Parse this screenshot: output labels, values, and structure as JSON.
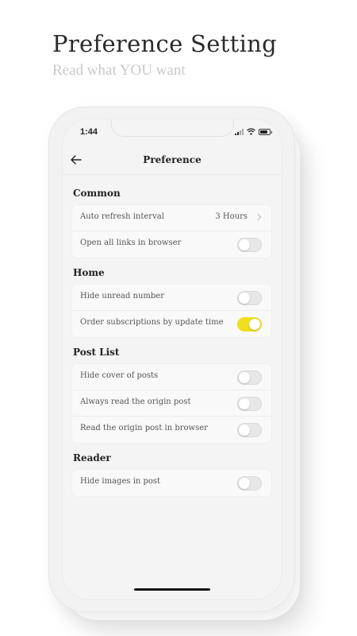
{
  "hero": {
    "title": "Preference Setting",
    "subtitle": "Read what YOU want"
  },
  "status_bar": {
    "time": "1:44",
    "icons": [
      "signal-icon",
      "wifi-icon",
      "battery-icon"
    ]
  },
  "nav": {
    "back_icon": "back-arrow-icon",
    "title": "Preference"
  },
  "colors": {
    "accent": "#f1de1e",
    "highlight": "#f3e43a",
    "background": "#f4f4f4"
  },
  "sections": {
    "common": {
      "title": "Common",
      "rows": [
        {
          "label": "Auto refresh interval",
          "value": "3 Hours",
          "type": "select"
        },
        {
          "label": "Open all links in browser",
          "type": "toggle",
          "on": false
        }
      ]
    },
    "home": {
      "title": "Home",
      "rows": [
        {
          "label": "Hide unread number",
          "type": "toggle",
          "on": false
        },
        {
          "label": "Order subscriptions by update time",
          "type": "toggle",
          "on": true
        }
      ]
    },
    "post_list": {
      "title": "Post List",
      "rows": [
        {
          "label": "Hide cover of posts",
          "type": "toggle",
          "on": false
        },
        {
          "label": "Always read the origin post",
          "type": "toggle",
          "on": false
        },
        {
          "label": "Read the origin post in browser",
          "type": "toggle",
          "on": false
        }
      ]
    },
    "reader": {
      "title": "Reader",
      "rows": [
        {
          "label": "Hide images in post",
          "type": "toggle",
          "on": false
        }
      ]
    }
  }
}
